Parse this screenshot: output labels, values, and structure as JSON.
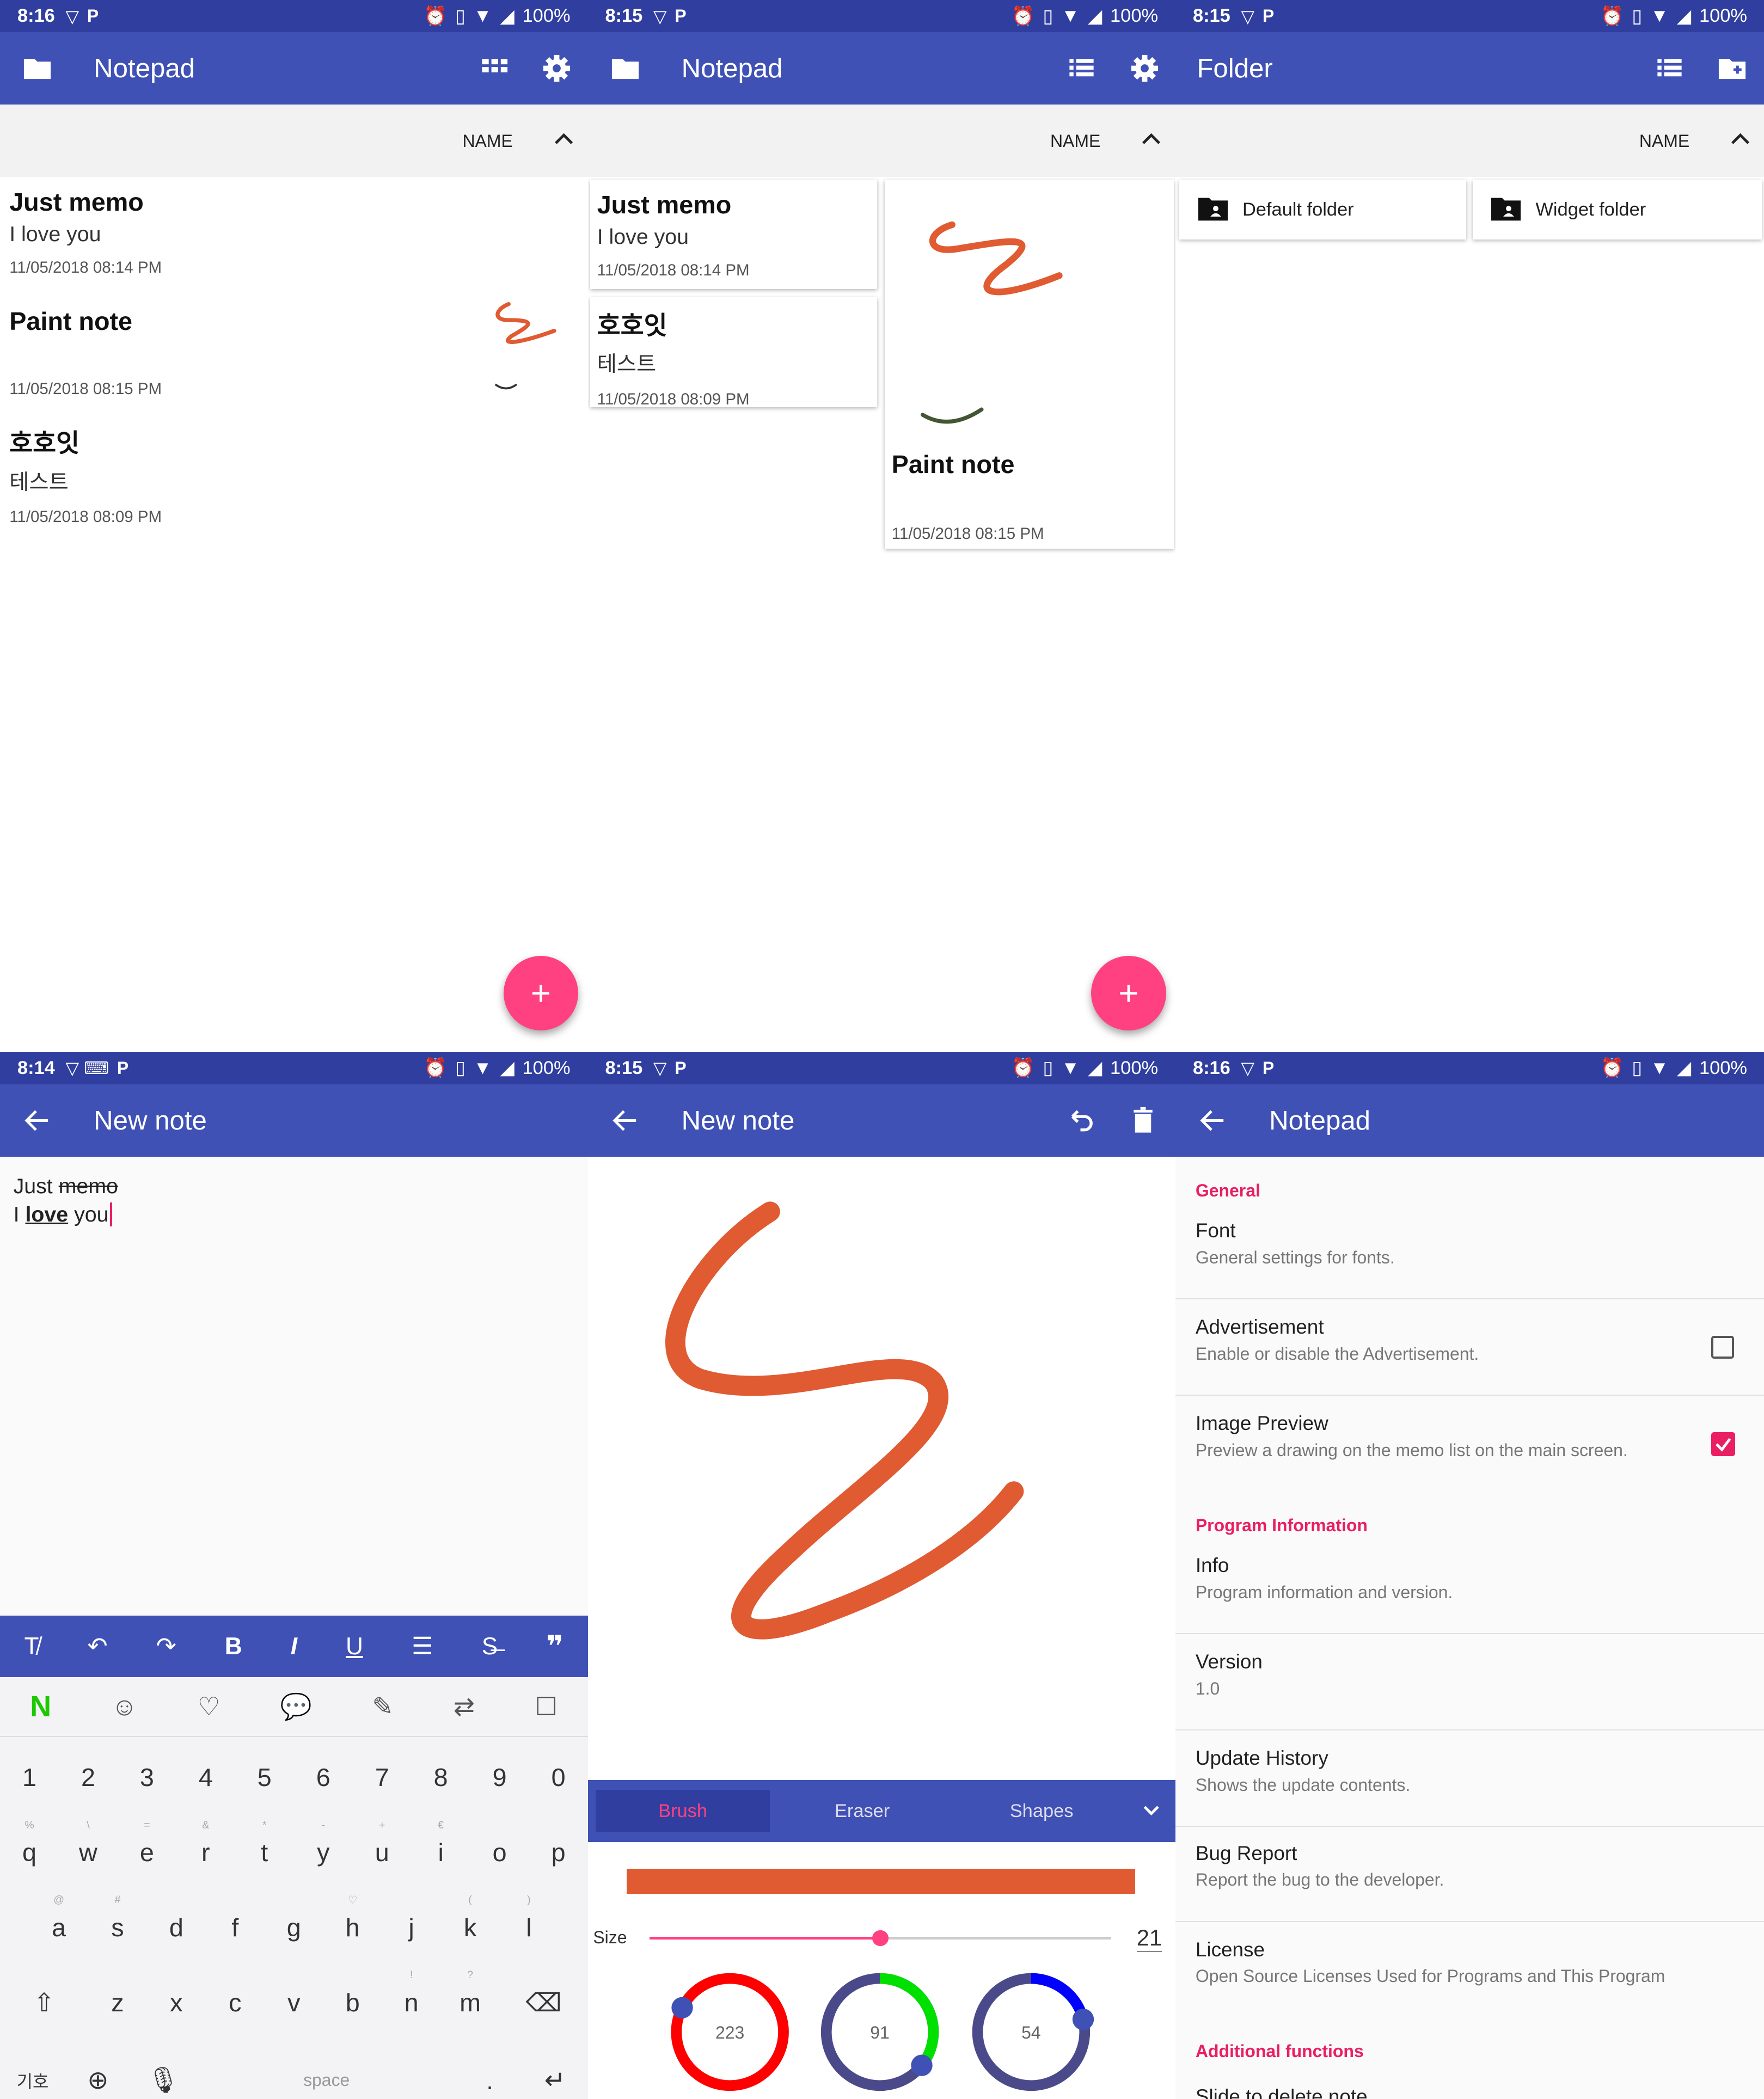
{
  "status_bars": [
    {
      "time": "8:16",
      "battery": "100%"
    },
    {
      "time": "8:15",
      "battery": "100%"
    },
    {
      "time": "8:15",
      "battery": "100%"
    },
    {
      "time": "8:14",
      "battery": "100%"
    },
    {
      "time": "8:15",
      "battery": "100%"
    },
    {
      "time": "8:16",
      "battery": "100%"
    }
  ],
  "colors": {
    "primary": "#3f51b5",
    "primary_dark": "#303f9f",
    "accent": "#ff4081",
    "paint": "#e05a32"
  },
  "list_view": {
    "title": "Notepad",
    "sort_label": "NAME",
    "memos": [
      {
        "title": "Just memo",
        "body": "I love you",
        "date": "11/05/2018 08:14 PM"
      },
      {
        "title": "Paint note",
        "body": "",
        "date": "11/05/2018 08:15 PM"
      },
      {
        "title": "호호잇",
        "body": "테스트",
        "date": "11/05/2018 08:09 PM"
      }
    ],
    "fab_icon": "+"
  },
  "grid_view": {
    "title": "Notepad",
    "sort_label": "NAME",
    "memos": [
      {
        "title": "Just memo",
        "body": "I love you",
        "date": "11/05/2018 08:14 PM"
      },
      {
        "title": "호호잇",
        "body": "테스트",
        "date": "11/05/2018 08:09 PM"
      },
      {
        "title": "Paint note",
        "date": "11/05/2018 08:15 PM"
      }
    ],
    "fab_icon": "+"
  },
  "folder_view": {
    "title": "Folder",
    "sort_label": "NAME",
    "folders": [
      "Default folder",
      "Widget folder"
    ]
  },
  "text_editor": {
    "title": "New note",
    "line1_plain": "Just ",
    "line1_strike": "memo",
    "line2_plain": "I ",
    "line2_bold": "love",
    "line2_rest": " you",
    "format_toolbar": [
      "clear-format",
      "undo",
      "redo",
      "B",
      "I",
      "U",
      "list",
      "strikethrough",
      "quote"
    ],
    "keyboard": {
      "numbers": [
        "1",
        "2",
        "3",
        "4",
        "5",
        "6",
        "7",
        "8",
        "9",
        "0"
      ],
      "row1": [
        "q",
        "w",
        "e",
        "r",
        "t",
        "y",
        "u",
        "i",
        "o",
        "p"
      ],
      "row1_hints": [
        "%",
        "\\",
        "=",
        "&",
        "*",
        "-",
        "+",
        "€",
        "",
        ""
      ],
      "row2": [
        "a",
        "s",
        "d",
        "f",
        "g",
        "h",
        "j",
        "k",
        "l"
      ],
      "row2_hints": [
        "@",
        "#",
        "",
        "",
        "",
        "♡",
        "",
        "(",
        ")"
      ],
      "row3": [
        "z",
        "x",
        "c",
        "v",
        "b",
        "n",
        "m"
      ],
      "row3_hints": [
        "",
        "",
        "",
        "",
        "",
        "!",
        "?"
      ],
      "bottom": {
        "symbols": "기호",
        "space": "space",
        "period": "."
      }
    }
  },
  "paint_editor": {
    "title": "New note",
    "tabs": [
      "Brush",
      "Eraser",
      "Shapes"
    ],
    "active_tab": "Brush",
    "size_label": "Size",
    "size_value": "21",
    "size_fraction": 0.5,
    "rgb": {
      "r": "223",
      "g": "91",
      "b": "54"
    },
    "rgb_fraction": {
      "r": 0.875,
      "g": 0.357,
      "b": 0.212
    }
  },
  "settings": {
    "title": "Notepad",
    "general_header": "General",
    "items": [
      {
        "title": "Font",
        "subtitle": "General settings for fonts."
      },
      {
        "title": "Advertisement",
        "subtitle": "Enable or disable the Advertisement."
      },
      {
        "title": "Image Preview",
        "subtitle": "Preview a drawing on the memo list on the main screen."
      }
    ],
    "program_header": "Program Information",
    "program_items": [
      {
        "title": "Info",
        "subtitle": "Program information and version."
      },
      {
        "title": "Version",
        "subtitle": "1.0"
      },
      {
        "title": "Update History",
        "subtitle": "Shows the update contents."
      },
      {
        "title": "Bug Report",
        "subtitle": "Report the bug to the developer."
      },
      {
        "title": "License",
        "subtitle": "Open Source Licenses Used for Programs and This Program"
      }
    ],
    "additional_header": "Additional functions",
    "partial_item": "Slide to delete note",
    "advertisement_checked": false,
    "image_preview_checked": true
  }
}
